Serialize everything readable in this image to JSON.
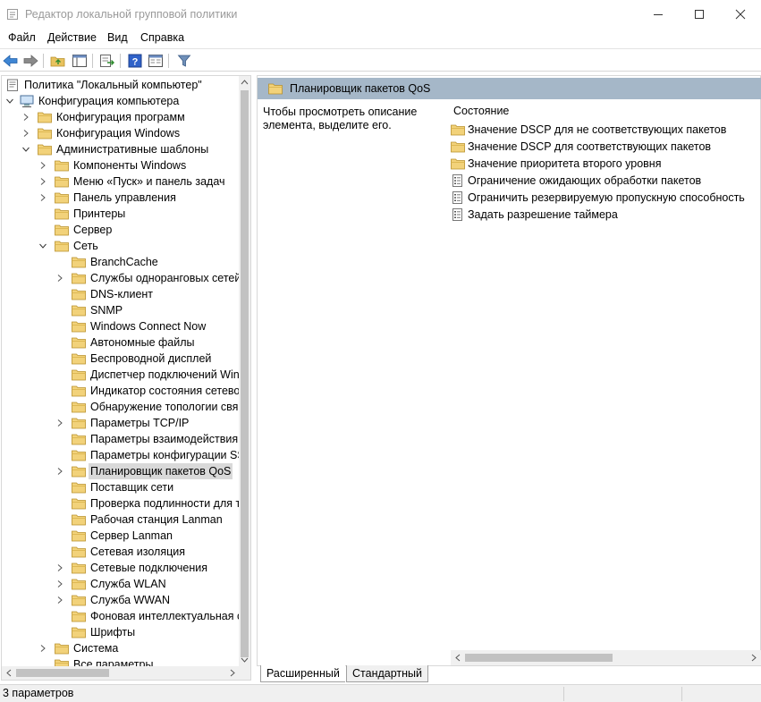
{
  "window": {
    "title": "Редактор локальной групповой политики"
  },
  "menu": [
    "Файл",
    "Действие",
    "Вид",
    "Справка"
  ],
  "tree": [
    {
      "label": "Политика \"Локальный компьютер\"",
      "level": 0,
      "expander": "none",
      "icon": "policy"
    },
    {
      "label": "Конфигурация компьютера",
      "level": 0,
      "expander": "down",
      "icon": "computer"
    },
    {
      "label": "Конфигурация программ",
      "level": 1,
      "expander": "right",
      "icon": "folder"
    },
    {
      "label": "Конфигурация Windows",
      "level": 1,
      "expander": "right",
      "icon": "folder"
    },
    {
      "label": "Административные шаблоны",
      "level": 1,
      "expander": "down",
      "icon": "folder"
    },
    {
      "label": "Компоненты Windows",
      "level": 2,
      "expander": "right",
      "icon": "folder"
    },
    {
      "label": "Меню «Пуск» и панель задач",
      "level": 2,
      "expander": "right",
      "icon": "folder"
    },
    {
      "label": "Панель управления",
      "level": 2,
      "expander": "right",
      "icon": "folder"
    },
    {
      "label": "Принтеры",
      "level": 2,
      "expander": "none",
      "icon": "folder"
    },
    {
      "label": "Сервер",
      "level": 2,
      "expander": "none",
      "icon": "folder"
    },
    {
      "label": "Сеть",
      "level": 2,
      "expander": "down",
      "icon": "folder"
    },
    {
      "label": "BranchCache",
      "level": 3,
      "expander": "none",
      "icon": "folder"
    },
    {
      "label": "Службы одноранговых сетей",
      "level": 3,
      "expander": "right",
      "icon": "folder"
    },
    {
      "label": "DNS-клиент",
      "level": 3,
      "expander": "none",
      "icon": "folder"
    },
    {
      "label": "SNMP",
      "level": 3,
      "expander": "none",
      "icon": "folder"
    },
    {
      "label": "Windows Connect Now",
      "level": 3,
      "expander": "none",
      "icon": "folder"
    },
    {
      "label": "Автономные файлы",
      "level": 3,
      "expander": "none",
      "icon": "folder"
    },
    {
      "label": "Беспроводной дисплей",
      "level": 3,
      "expander": "none",
      "icon": "folder"
    },
    {
      "label": "Диспетчер подключений Win",
      "level": 3,
      "expander": "none",
      "icon": "folder"
    },
    {
      "label": "Индикатор состояния сетевог",
      "level": 3,
      "expander": "none",
      "icon": "folder"
    },
    {
      "label": "Обнаружение топологии связ",
      "level": 3,
      "expander": "none",
      "icon": "folder"
    },
    {
      "label": "Параметры TCP/IP",
      "level": 3,
      "expander": "right",
      "icon": "folder"
    },
    {
      "label": "Параметры взаимодействия к",
      "level": 3,
      "expander": "none",
      "icon": "folder"
    },
    {
      "label": "Параметры конфигурации SS",
      "level": 3,
      "expander": "none",
      "icon": "folder"
    },
    {
      "label": "Планировщик пакетов QoS",
      "level": 3,
      "expander": "right",
      "icon": "folder",
      "selected": true
    },
    {
      "label": "Поставщик сети",
      "level": 3,
      "expander": "none",
      "icon": "folder"
    },
    {
      "label": "Проверка подлинности для те",
      "level": 3,
      "expander": "none",
      "icon": "folder"
    },
    {
      "label": "Рабочая станция Lanman",
      "level": 3,
      "expander": "none",
      "icon": "folder"
    },
    {
      "label": "Сервер Lanman",
      "level": 3,
      "expander": "none",
      "icon": "folder"
    },
    {
      "label": "Сетевая изоляция",
      "level": 3,
      "expander": "none",
      "icon": "folder"
    },
    {
      "label": "Сетевые подключения",
      "level": 3,
      "expander": "right",
      "icon": "folder"
    },
    {
      "label": "Служба WLAN",
      "level": 3,
      "expander": "right",
      "icon": "folder"
    },
    {
      "label": "Служба WWAN",
      "level": 3,
      "expander": "right",
      "icon": "folder"
    },
    {
      "label": "Фоновая интеллектуальная сл",
      "level": 3,
      "expander": "none",
      "icon": "folder"
    },
    {
      "label": "Шрифты",
      "level": 3,
      "expander": "none",
      "icon": "folder"
    },
    {
      "label": "Система",
      "level": 2,
      "expander": "right",
      "icon": "folder"
    },
    {
      "label": "Все параметры",
      "level": 2,
      "expander": "none",
      "icon": "folder"
    }
  ],
  "right": {
    "header": "Планировщик пакетов QoS",
    "description": "Чтобы просмотреть описание элемента, выделите его.",
    "column": "Состояние",
    "items": [
      {
        "label": "Значение DSCP для не соответствующих пакетов",
        "icon": "folder"
      },
      {
        "label": "Значение DSCP для соответствующих пакетов",
        "icon": "folder"
      },
      {
        "label": "Значение приоритета второго уровня",
        "icon": "folder"
      },
      {
        "label": "Ограничение ожидающих обработки пакетов",
        "icon": "setting"
      },
      {
        "label": "Ограничить резервируемую пропускную способность",
        "icon": "setting"
      },
      {
        "label": "Задать разрешение таймера",
        "icon": "setting"
      }
    ]
  },
  "tabs": [
    "Расширенный",
    "Стандартный"
  ],
  "status": "3 параметров",
  "colors": {
    "header_band": "#a5b7c8",
    "folder": "#e8c25e",
    "selection": "#d9d9d9",
    "help_blue": "#2f62c9"
  }
}
